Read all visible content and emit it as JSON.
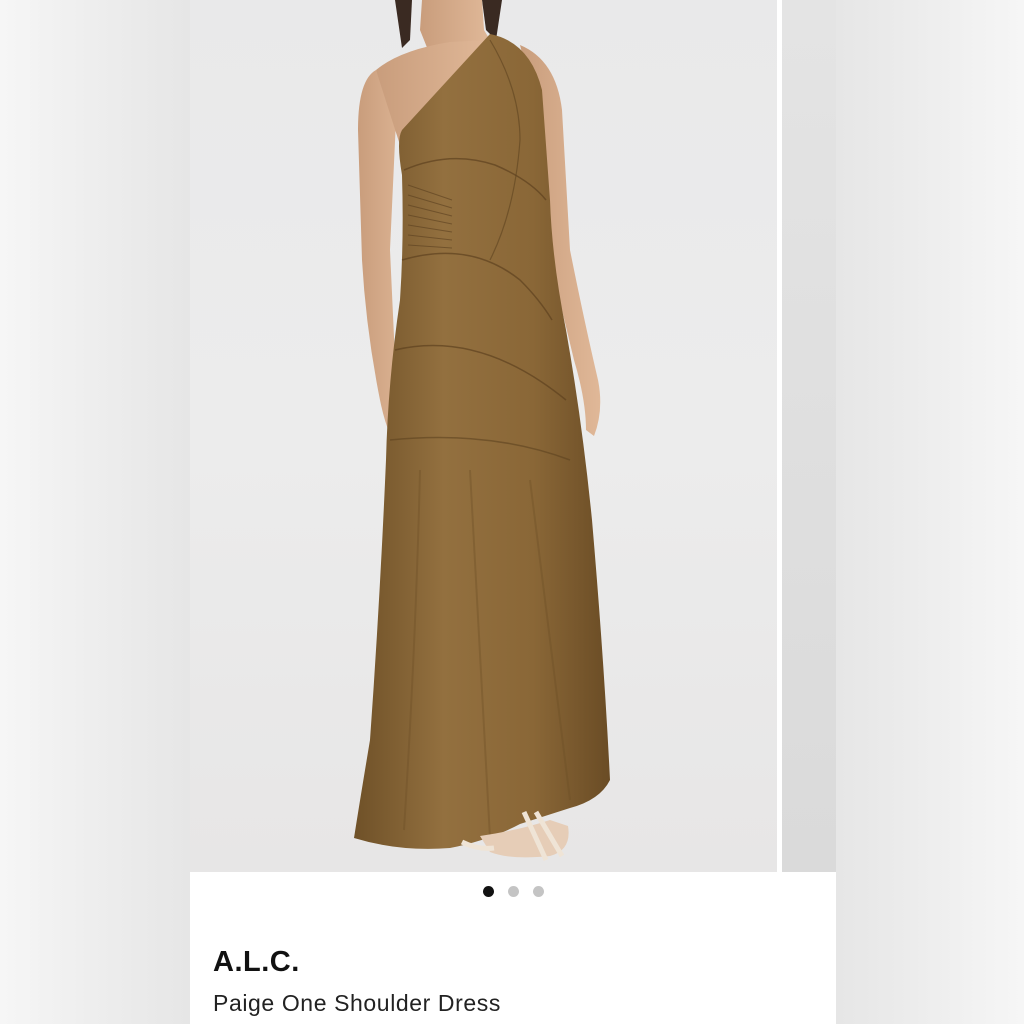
{
  "product": {
    "brand": "A.L.C.",
    "name": "Paige One Shoulder Dress",
    "image_subject": "model wearing brown one-shoulder maxi dress"
  },
  "carousel": {
    "total_images": 3,
    "active_index": 1
  },
  "colors": {
    "dress": "#8e6a3a",
    "background": "#ffffff",
    "active_dot": "#111111",
    "inactive_dot": "#c4c4c4"
  }
}
